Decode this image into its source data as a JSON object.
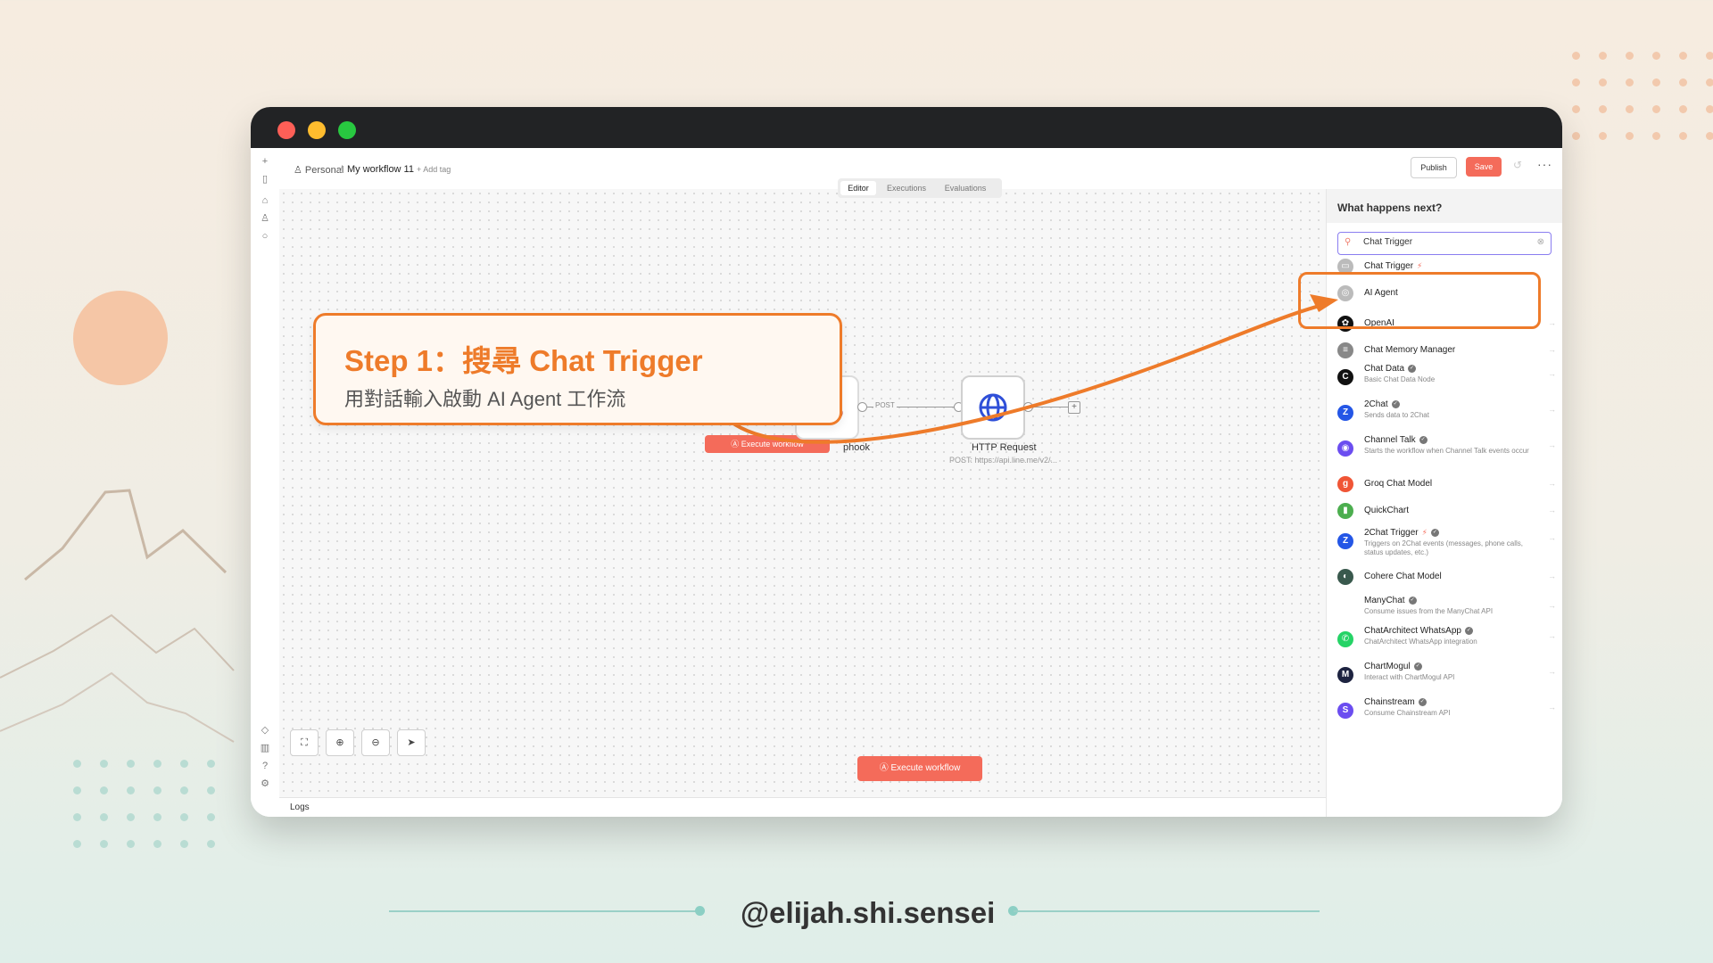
{
  "colors": {
    "accent_orange": "#ee7b2a",
    "n8n_red": "#f46b5a",
    "footer_teal": "#8ccfc4"
  },
  "topbar": {
    "breadcrumb_personal": "Personal",
    "breadcrumb_sep": "/",
    "workflow_name": "My workflow 11",
    "add_tag": "+ Add tag",
    "publish_label": "Publish",
    "save_label": "Save",
    "more_icon": "more-horizontal-icon"
  },
  "tabs": [
    "Editor",
    "Executions",
    "Evaluations"
  ],
  "canvas": {
    "execute_label": "Execute workflow",
    "execute_ghost_label": "Execute workflow",
    "webhook_label": "phook",
    "http_label": "HTTP Request",
    "http_sub": "POST: https://api.line.me/v2/...",
    "connection_label": "POST",
    "plus": "+",
    "logs_label": "Logs"
  },
  "panel": {
    "title": "What happens next?",
    "search_value": "Chat Trigger",
    "items": [
      {
        "title": "Chat Trigger",
        "desc": "",
        "icon": "chat-trigger-icon",
        "color": "#bbbbbb",
        "glyph": "▭",
        "bolt": true,
        "verified": false
      },
      {
        "title": "AI Agent",
        "desc": "",
        "icon": "ai-agent-icon",
        "color": "#bbbbbb",
        "glyph": "◎",
        "bolt": false,
        "verified": false
      },
      {
        "title": "OpenAI",
        "desc": "",
        "icon": "openai-icon",
        "color": "#111111",
        "glyph": "✿",
        "bolt": false,
        "verified": false
      },
      {
        "title": "Chat Memory Manager",
        "desc": "",
        "icon": "database-icon",
        "color": "#888888",
        "glyph": "≡",
        "bolt": false,
        "verified": false
      },
      {
        "title": "Chat Data",
        "desc": "Basic Chat Data Node",
        "icon": "chat-data-icon",
        "color": "#111111",
        "glyph": "C",
        "bolt": false,
        "verified": true
      },
      {
        "title": "2Chat",
        "desc": "Sends data to 2Chat",
        "icon": "2chat-icon",
        "color": "#2456e6",
        "glyph": "Z",
        "bolt": false,
        "verified": true
      },
      {
        "title": "Channel Talk",
        "desc": "Starts the workflow when Channel Talk events occur",
        "icon": "channel-talk-icon",
        "color": "#6b4df0",
        "glyph": "◉",
        "bolt": false,
        "verified": true
      },
      {
        "title": "Groq Chat Model",
        "desc": "",
        "icon": "groq-icon",
        "color": "#f05536",
        "glyph": "g",
        "bolt": false,
        "verified": false
      },
      {
        "title": "QuickChart",
        "desc": "",
        "icon": "quickchart-icon",
        "color": "#4cae4f",
        "glyph": "▮",
        "bolt": false,
        "verified": false
      },
      {
        "title": "2Chat Trigger",
        "desc": "Triggers on 2Chat events (messages, phone calls, status updates, etc.)",
        "icon": "2chat-trigger-icon",
        "color": "#2456e6",
        "glyph": "Z",
        "bolt": true,
        "verified": true
      },
      {
        "title": "Cohere Chat Model",
        "desc": "",
        "icon": "cohere-icon",
        "color": "#39594d",
        "glyph": "◐",
        "bolt": false,
        "verified": false
      },
      {
        "title": "ManyChat",
        "desc": "Consume issues from the ManyChat API",
        "icon": "manychat-icon",
        "color": "#ffffff",
        "glyph": "",
        "bolt": false,
        "verified": true
      },
      {
        "title": "ChatArchitect WhatsApp",
        "desc": "ChatArchitect WhatsApp integration",
        "icon": "whatsapp-icon",
        "color": "#25d366",
        "glyph": "✆",
        "bolt": false,
        "verified": true
      },
      {
        "title": "ChartMogul",
        "desc": "Interact with ChartMogul API",
        "icon": "chartmogul-icon",
        "color": "#1d2340",
        "glyph": "M",
        "bolt": false,
        "verified": true
      },
      {
        "title": "Chainstream",
        "desc": "Consume Chainstream API",
        "icon": "chainstream-icon",
        "color": "#6b4df0",
        "glyph": "S",
        "bolt": false,
        "verified": true
      }
    ]
  },
  "callout": {
    "title": "Step 1：搜尋 Chat Trigger",
    "subtitle": "用對話輸入啟動 AI Agent 工作流"
  },
  "footer": {
    "handle": "@elijah.shi.sensei"
  }
}
